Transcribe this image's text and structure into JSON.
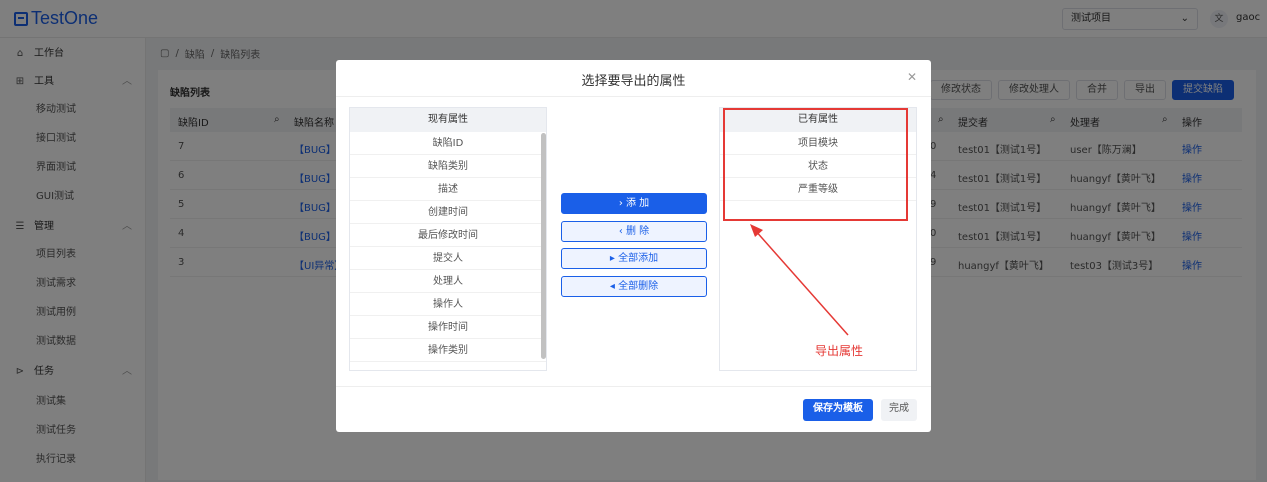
{
  "app": {
    "logo_text": "TestOne",
    "project_select": "测试项目",
    "user": "gaoc"
  },
  "sidebar": {
    "groups": [
      {
        "label": "工作台",
        "icon": "home-icon",
        "items": []
      },
      {
        "label": "工具",
        "icon": "grid-icon",
        "items": [
          "移动测试",
          "接口测试",
          "界面测试",
          "GUI测试"
        ]
      },
      {
        "label": "管理",
        "icon": "list-icon",
        "items": [
          "项目列表",
          "测试需求",
          "测试用例",
          "测试数据"
        ]
      },
      {
        "label": "任务",
        "icon": "flag-icon",
        "items": [
          "测试集",
          "测试任务",
          "执行记录"
        ]
      }
    ]
  },
  "breadcrumb": {
    "sep": "/",
    "items": [
      "缺陷",
      "缺陷列表"
    ]
  },
  "list": {
    "title": "缺陷列表",
    "actions": [
      "修改状态",
      "修改处理人",
      "合并",
      "导出",
      "提交缺陷"
    ],
    "columns": [
      "缺陷ID",
      "缺陷名称",
      "提交者",
      "处理者",
      "操作"
    ],
    "rows": [
      {
        "id": "7",
        "name": "【BUG】",
        "status": "0",
        "submitter": "test01【测试1号】",
        "handler": "user【陈万澜】",
        "op": "操作"
      },
      {
        "id": "6",
        "name": "【BUG】",
        "status": "4",
        "submitter": "test01【测试1号】",
        "handler": "huangyf【黄叶飞】",
        "op": "操作"
      },
      {
        "id": "5",
        "name": "【BUG】",
        "status": "9",
        "submitter": "test01【测试1号】",
        "handler": "huangyf【黄叶飞】",
        "op": "操作"
      },
      {
        "id": "4",
        "name": "【BUG】",
        "status": "0",
        "submitter": "test01【测试1号】",
        "handler": "huangyf【黄叶飞】",
        "op": "操作"
      },
      {
        "id": "3",
        "name": "【UI异常】",
        "status": "9",
        "submitter": "huangyf【黄叶飞】",
        "handler": "test03【测试3号】",
        "op": "操作"
      }
    ]
  },
  "modal": {
    "title": "选择要导出的属性",
    "left_header": "现有属性",
    "left_items": [
      "缺陷ID",
      "缺陷类别",
      "描述",
      "创建时间",
      "最后修改时间",
      "提交人",
      "处理人",
      "操作人",
      "操作时间",
      "操作类别"
    ],
    "right_header": "已有属性",
    "right_items": [
      "项目模块",
      "状态",
      "严重等级"
    ],
    "add_label": "› 添 加",
    "remove_label": "‹ 删 除",
    "add_all_label": "▸ 全部添加",
    "remove_all_label": "◂ 全部删除",
    "save_template_label": "保存为模板",
    "done_label": "完成"
  },
  "annotation": {
    "text": "导出属性",
    "color": "#e53935"
  },
  "colors": {
    "primary": "#1a5fe8"
  }
}
